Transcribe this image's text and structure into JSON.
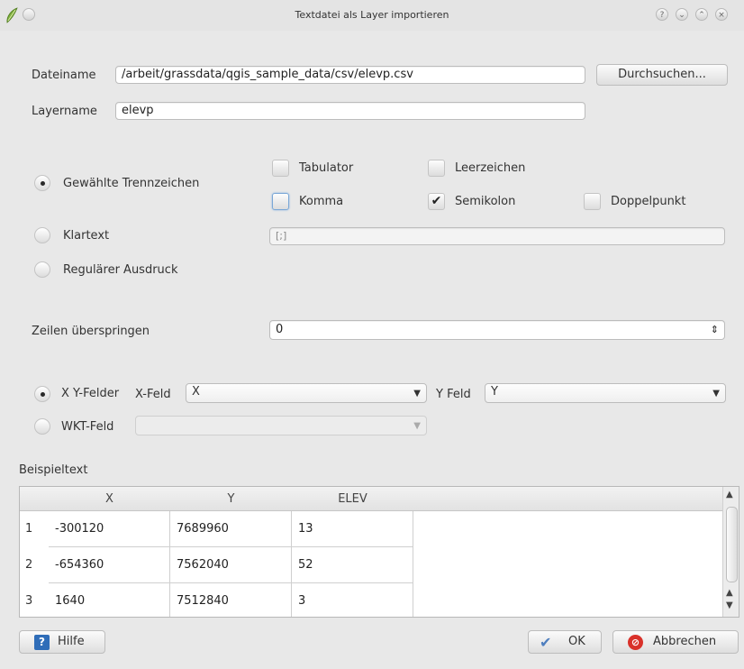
{
  "window": {
    "title": "Textdatei als Layer importieren",
    "controls": [
      "help-icon",
      "minimize-icon",
      "maximize-icon",
      "close-icon"
    ]
  },
  "file": {
    "label": "Dateiname",
    "value": "/arbeit/grassdata/qgis_sample_data/csv/elevp.csv",
    "browse_label": "Durchsuchen..."
  },
  "layer": {
    "label": "Layername",
    "value": "elevp"
  },
  "delimiter": {
    "selected_label": "Gewählte Trennzeichen",
    "plain_label": "Klartext",
    "regex_label": "Regulärer Ausdruck",
    "options": [
      {
        "label": "Tabulator",
        "checked": false
      },
      {
        "label": "Leerzeichen",
        "checked": false
      },
      {
        "label": "Komma",
        "checked": false
      },
      {
        "label": "Semikolon",
        "checked": true
      },
      {
        "label": "Doppelpunkt",
        "checked": false
      }
    ],
    "plain_value": "[;]"
  },
  "skip": {
    "label": "Zeilen überspringen",
    "value": "0"
  },
  "geometry": {
    "xy_label": "X Y-Felder",
    "xfield_label": "X-Feld",
    "xfield_value": "X",
    "yfield_label": "Y Feld",
    "yfield_value": "Y",
    "wkt_label": "WKT-Feld",
    "wkt_value": ""
  },
  "sample": {
    "label": "Beispieltext",
    "columns": [
      "X",
      "Y",
      "ELEV"
    ],
    "rows": [
      {
        "num": "1",
        "cells": [
          "-300120",
          "7689960",
          "13"
        ]
      },
      {
        "num": "2",
        "cells": [
          "-654360",
          "7562040",
          "52"
        ]
      },
      {
        "num": "3",
        "cells": [
          "1640",
          "7512840",
          "3"
        ]
      }
    ]
  },
  "buttons": {
    "help": "Hilfe",
    "ok": "OK",
    "cancel": "Abbrechen"
  },
  "colors": {
    "background": "#e8e8e8",
    "cancel_icon": "#d9312a",
    "help_icon": "#2f6db8",
    "ok_icon": "#4f7fbf"
  }
}
